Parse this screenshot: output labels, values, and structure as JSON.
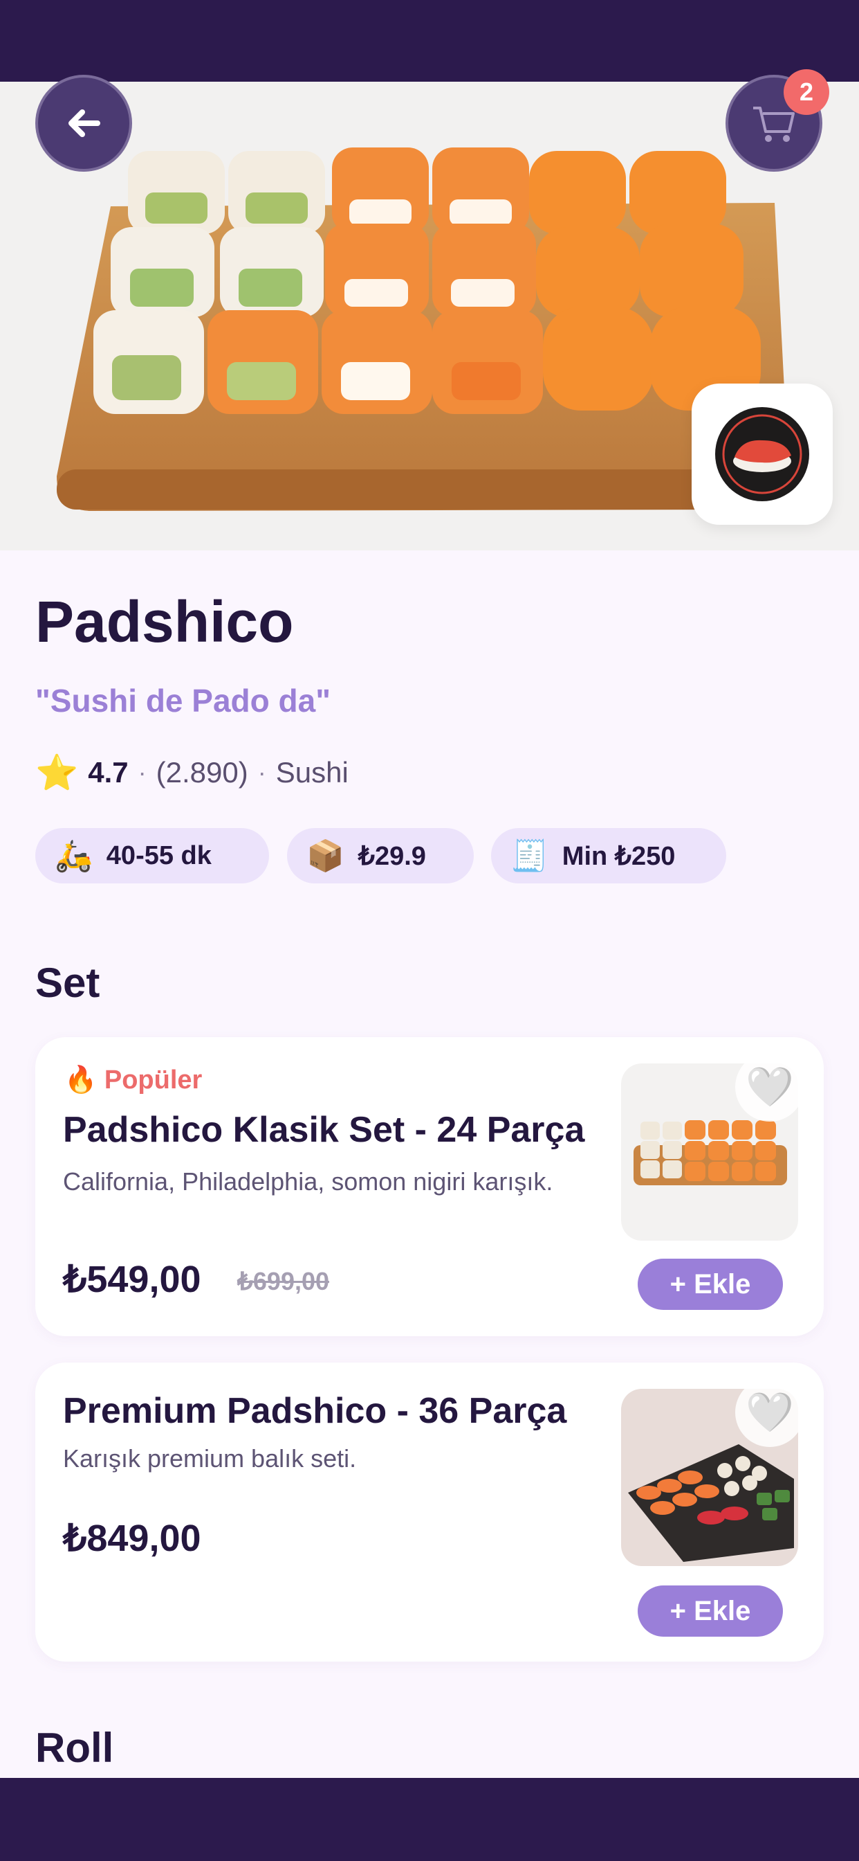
{
  "header": {
    "cart_count": "2",
    "icons": {
      "back": "arrow-left-icon",
      "cart": "shopping-cart-icon",
      "logo": "sushi-logo-icon"
    }
  },
  "restaurant": {
    "name": "Padshico",
    "slogan": "\"Sushi de Pado da\"",
    "rating": "4.7",
    "review_count": "(2.890)",
    "cuisine": "Sushi",
    "separator": "·",
    "star_icon": "⭐"
  },
  "chips": [
    {
      "icon": "🛵",
      "label": "40-55 dk"
    },
    {
      "icon": "📦",
      "label": "₺29.9"
    },
    {
      "icon": "🧾",
      "label": "Min ₺250"
    }
  ],
  "sections": [
    {
      "title": "Set"
    },
    {
      "title": "Roll"
    }
  ],
  "products": [
    {
      "badge": "🔥 Popüler",
      "name": "Padshico Klasik Set - 24 Parça",
      "description": "California, Philadelphia, somon nigiri karışık.",
      "price": "₺549,00",
      "old_price": "₺699,00",
      "add_label": "+ Ekle",
      "favorite_icon": "🤍"
    },
    {
      "name": "Premium Padshico - 36 Parça",
      "description": "Karışık premium balık seti.",
      "price": "₺849,00",
      "add_label": "+ Ekle",
      "favorite_icon": "🤍"
    }
  ],
  "colors": {
    "primary": "#9a7fd9",
    "dark": "#2c1a4d",
    "text": "#24173f",
    "badge": "#f26a6a",
    "background": "#fbf6fe"
  }
}
